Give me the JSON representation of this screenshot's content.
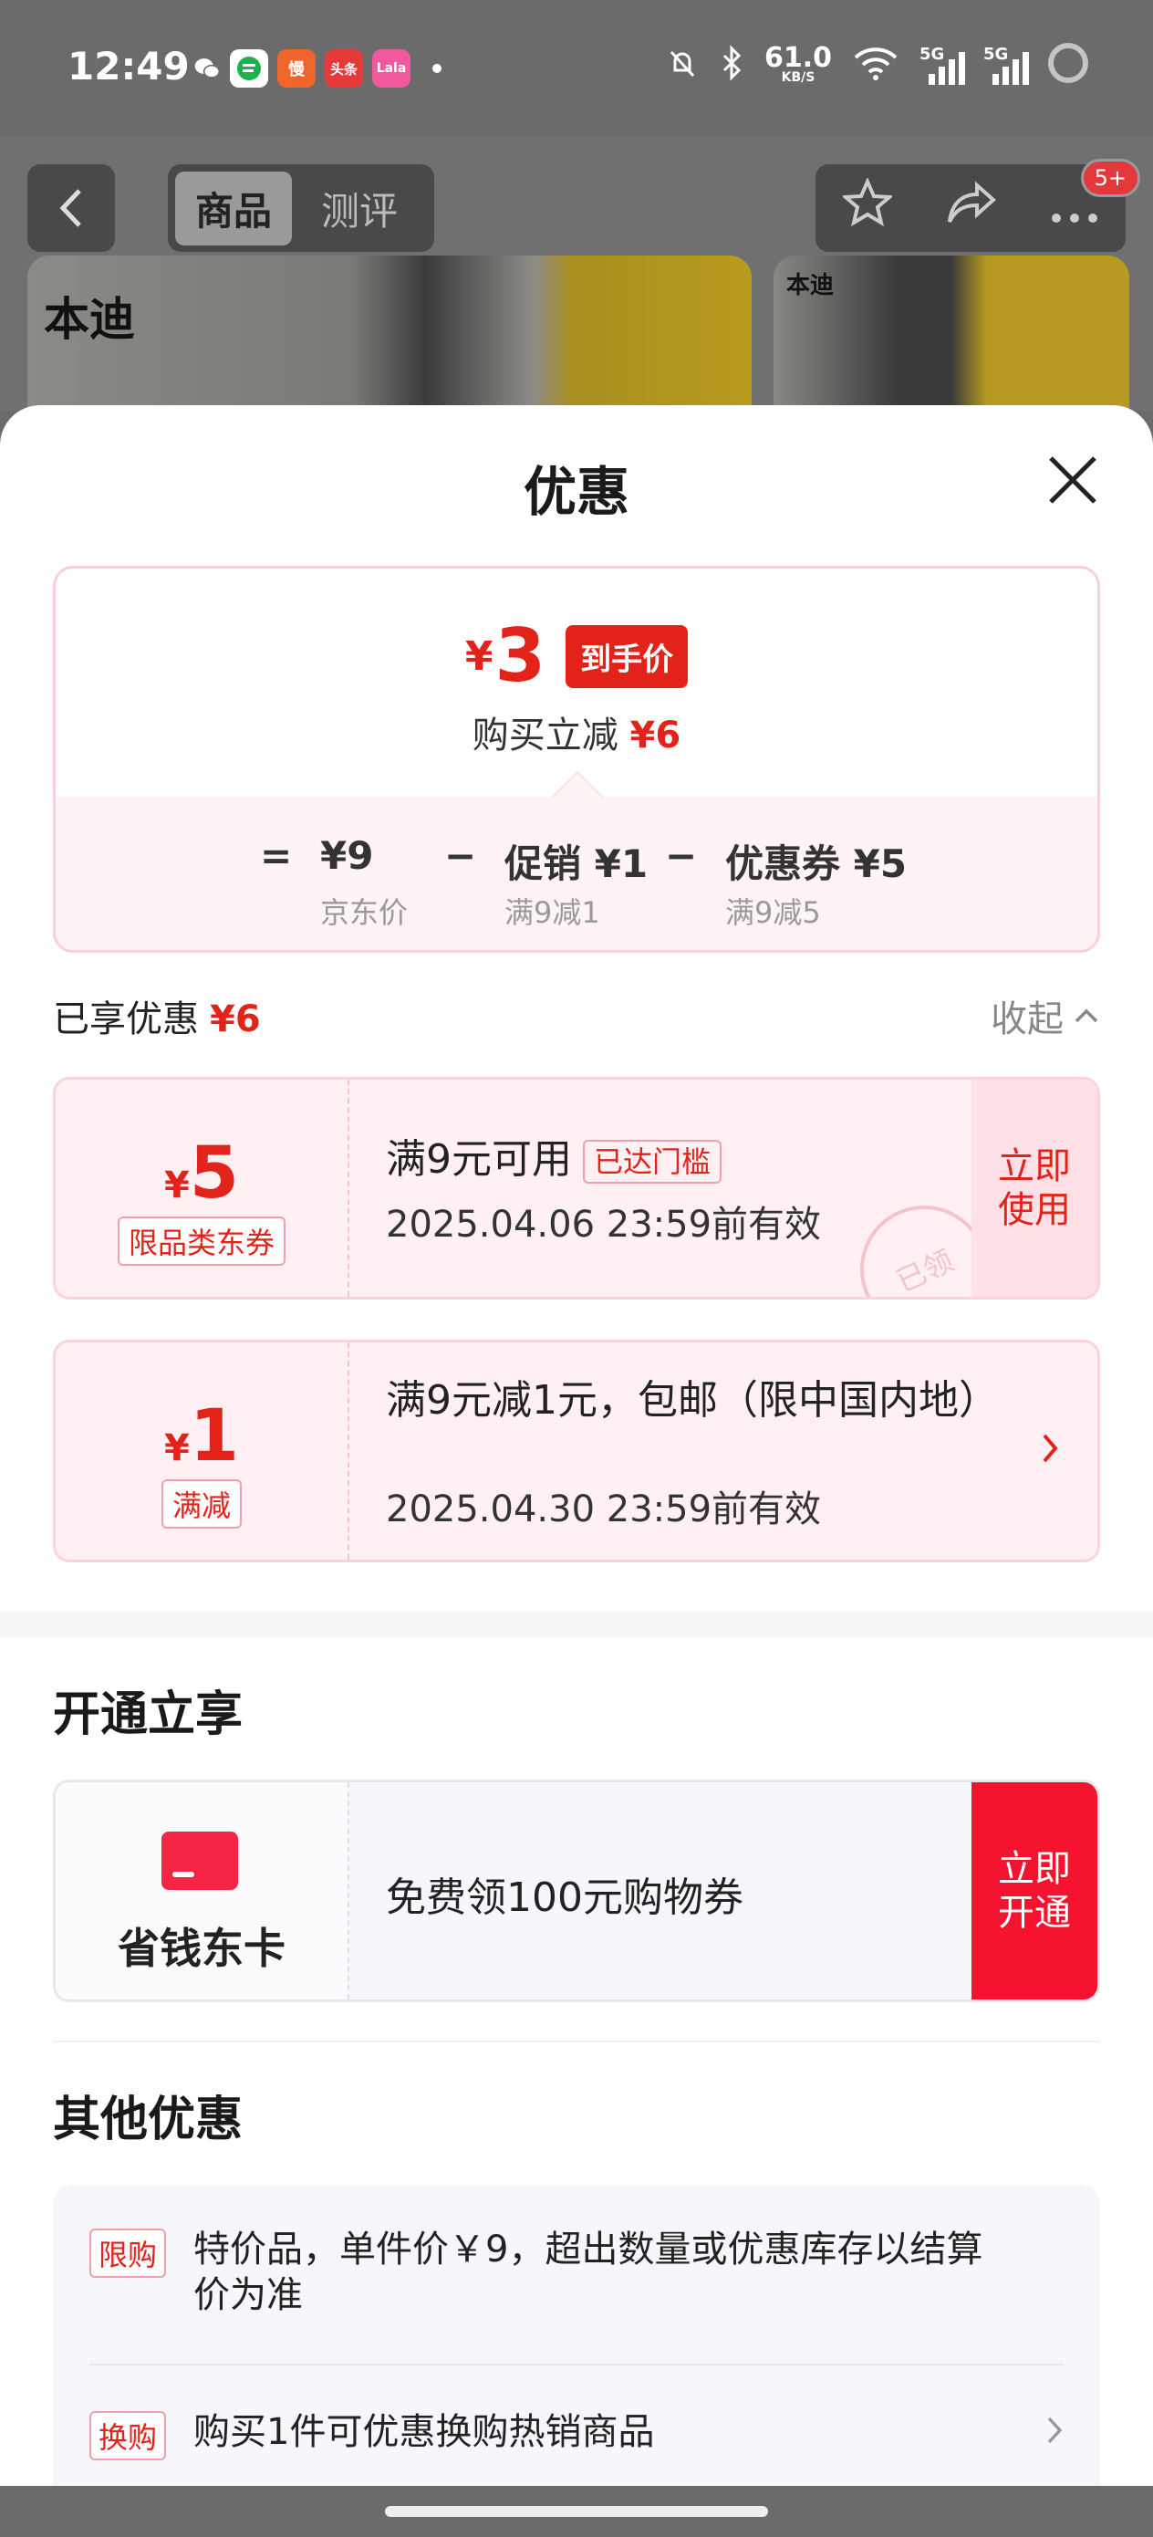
{
  "status_bar": {
    "time": "12:49",
    "net_speed": "61.0",
    "net_unit": "KB/S",
    "sig1": "5G",
    "sig2": "5G",
    "apps": [
      {
        "label": "",
        "color": "#1ab34b"
      },
      {
        "label": "慢",
        "color": "#f0642d"
      },
      {
        "label": "头条",
        "color": "#e63a3a"
      },
      {
        "label": "Lala",
        "color": "#f05a9c"
      }
    ]
  },
  "header": {
    "tabs": [
      {
        "label": "商品",
        "active": true
      },
      {
        "label": "测评",
        "active": false
      }
    ],
    "badge": "5+"
  },
  "product": {
    "brand": "本迪"
  },
  "sheet": {
    "title": "优惠",
    "price": {
      "currency": "¥",
      "value": "3",
      "tag": "到手价",
      "sub_label": "购买立减",
      "sub_value": "¥6"
    },
    "formula": {
      "eq": "=",
      "items": [
        {
          "value": "¥9",
          "label": "京东价"
        },
        {
          "op": "−"
        },
        {
          "value": "促销 ¥1",
          "label": "满9减1"
        },
        {
          "op": "−"
        },
        {
          "value": "优惠券 ¥5",
          "label": "满9减5"
        }
      ]
    },
    "enjoyed": {
      "label": "已享优惠",
      "value": "¥6",
      "collapse": "收起"
    },
    "coupons": [
      {
        "currency": "¥",
        "amount": "5",
        "tag": "限品类东券",
        "title": "满9元可用",
        "threshold": "已达门槛",
        "date": "2025.04.06 23:59前有效",
        "action": "立即使用",
        "stamp": "已领"
      },
      {
        "currency": "¥",
        "amount": "1",
        "tag": "满减",
        "title": "满9元减1元，包邮（限中国内地）",
        "date": "2025.04.30 23:59前有效"
      }
    ],
    "membership": {
      "section_title": "开通立享",
      "card_name": "省钱东卡",
      "desc": "免费领100元购物券",
      "action": "立即开通"
    },
    "others": {
      "section_title": "其他优惠",
      "items": [
        {
          "tag": "限购",
          "text": "特价品，单件价￥9，超出数量或优惠库存以结算价为准"
        },
        {
          "tag": "换购",
          "text": "购买1件可优惠换购热销商品"
        }
      ]
    }
  }
}
